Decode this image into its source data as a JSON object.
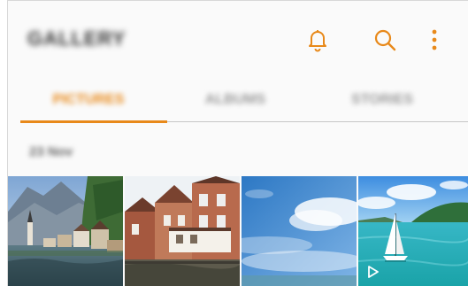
{
  "app": {
    "title": "GALLERY"
  },
  "header": {
    "icons": [
      "bell-icon",
      "search-icon",
      "more-options-icon"
    ]
  },
  "tabs": [
    {
      "label": "PICTURES",
      "selected": true
    },
    {
      "label": "ALBUMS",
      "selected": false
    },
    {
      "label": "STORIES",
      "selected": false
    }
  ],
  "section": {
    "date": "23 Nov"
  },
  "thumbnails": [
    {
      "name": "alpine-lake-village"
    },
    {
      "name": "canal-houses"
    },
    {
      "name": "blue-sky-clouds"
    },
    {
      "name": "sailboat-lagoon",
      "is_video": true
    }
  ],
  "colors": {
    "accent": "#e8891a",
    "inactive_tab": "#9a9a9a",
    "background": "#fafafa"
  }
}
